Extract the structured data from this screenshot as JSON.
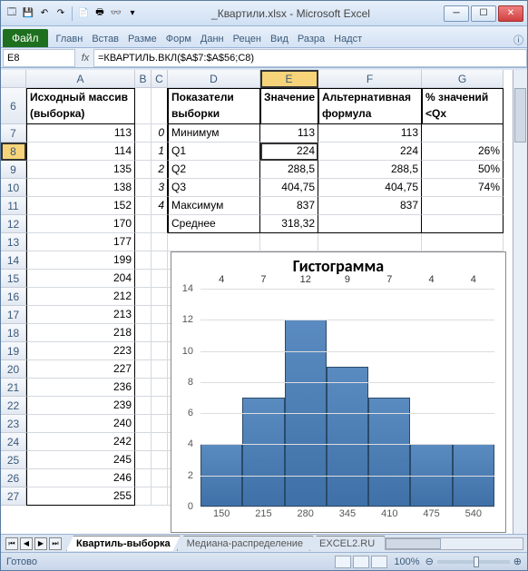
{
  "window": {
    "title": "_Квартили.xlsx - Microsoft Excel"
  },
  "ribbon": {
    "file": "Файл",
    "tabs": [
      "Главн",
      "Встав",
      "Разме",
      "Форм",
      "Данн",
      "Рецен",
      "Вид",
      "Разра",
      "Надст"
    ]
  },
  "formula_bar": {
    "name_box": "E8",
    "fx": "fx",
    "formula": "=КВАРТИЛЬ.ВКЛ($A$7:$A$56;C8)"
  },
  "columns": [
    "",
    "A",
    "B",
    "C",
    "D",
    "E",
    "F",
    "G"
  ],
  "headers": {
    "col_a": "Исходный массив (выборка)",
    "col_d": "Показатели выборки",
    "col_e": "Значение",
    "col_f": "Альтернативная формула",
    "col_g": "% значений <Qx"
  },
  "rows_a": [
    {
      "row": 7,
      "v": "113"
    },
    {
      "row": 8,
      "v": "114"
    },
    {
      "row": 9,
      "v": "135"
    },
    {
      "row": 10,
      "v": "138"
    },
    {
      "row": 11,
      "v": "152"
    },
    {
      "row": 12,
      "v": "170"
    },
    {
      "row": 13,
      "v": "177"
    },
    {
      "row": 14,
      "v": "199"
    },
    {
      "row": 15,
      "v": "204"
    },
    {
      "row": 16,
      "v": "212"
    },
    {
      "row": 17,
      "v": "213"
    },
    {
      "row": 18,
      "v": "218"
    },
    {
      "row": 19,
      "v": "223"
    },
    {
      "row": 20,
      "v": "227"
    },
    {
      "row": 21,
      "v": "236"
    },
    {
      "row": 22,
      "v": "239"
    },
    {
      "row": 23,
      "v": "240"
    },
    {
      "row": 24,
      "v": "242"
    },
    {
      "row": 25,
      "v": "245"
    },
    {
      "row": 26,
      "v": "246"
    },
    {
      "row": 27,
      "v": "255"
    }
  ],
  "stats": [
    {
      "row": 7,
      "c": "0",
      "d": "Минимум",
      "e": "113",
      "f": "113",
      "g": ""
    },
    {
      "row": 8,
      "c": "1",
      "d": "Q1",
      "e": "224",
      "f": "224",
      "g": "26%"
    },
    {
      "row": 9,
      "c": "2",
      "d": "Q2",
      "e": "288,5",
      "f": "288,5",
      "g": "50%"
    },
    {
      "row": 10,
      "c": "3",
      "d": "Q3",
      "e": "404,75",
      "f": "404,75",
      "g": "74%"
    },
    {
      "row": 11,
      "c": "4",
      "d": "Максимум",
      "e": "837",
      "f": "837",
      "g": ""
    },
    {
      "row": 12,
      "c": "",
      "d": "Среднее",
      "e": "318,32",
      "f": "",
      "g": ""
    }
  ],
  "chart_data": {
    "type": "bar",
    "title": "Гистограмма",
    "categories": [
      "150",
      "215",
      "280",
      "345",
      "410",
      "475",
      "540"
    ],
    "values": [
      4,
      7,
      12,
      9,
      7,
      4,
      4
    ],
    "ylim": [
      0,
      14
    ],
    "yticks": [
      0,
      2,
      4,
      6,
      8,
      10,
      12,
      14
    ]
  },
  "sheet_tabs": {
    "active": "Квартиль-выборка",
    "others": [
      "Медиана-распределение",
      "EXCEL2.RU"
    ]
  },
  "status": {
    "ready": "Готово",
    "zoom": "100%"
  }
}
